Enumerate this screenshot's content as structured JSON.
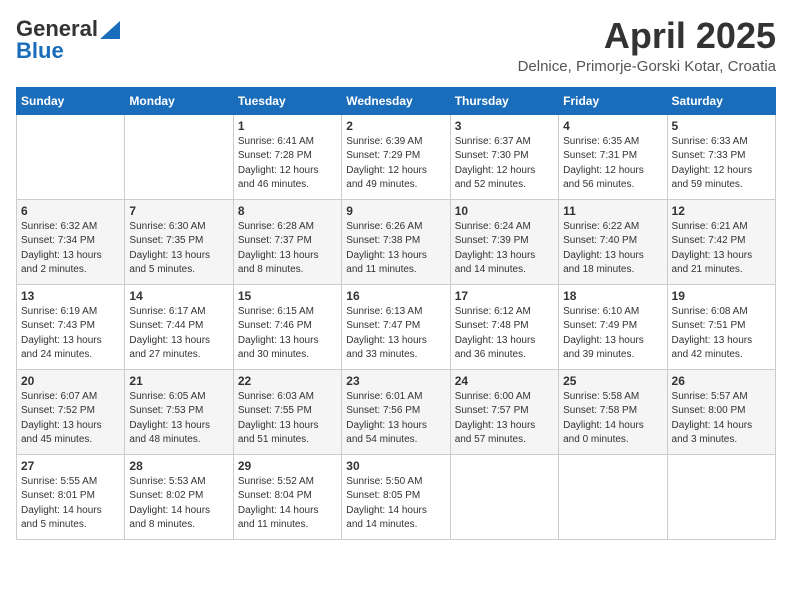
{
  "header": {
    "logo_general": "General",
    "logo_blue": "Blue",
    "month_title": "April 2025",
    "location": "Delnice, Primorje-Gorski Kotar, Croatia"
  },
  "days_of_week": [
    "Sunday",
    "Monday",
    "Tuesday",
    "Wednesday",
    "Thursday",
    "Friday",
    "Saturday"
  ],
  "weeks": [
    [
      {
        "day": "",
        "detail": ""
      },
      {
        "day": "",
        "detail": ""
      },
      {
        "day": "1",
        "detail": "Sunrise: 6:41 AM\nSunset: 7:28 PM\nDaylight: 12 hours\nand 46 minutes."
      },
      {
        "day": "2",
        "detail": "Sunrise: 6:39 AM\nSunset: 7:29 PM\nDaylight: 12 hours\nand 49 minutes."
      },
      {
        "day": "3",
        "detail": "Sunrise: 6:37 AM\nSunset: 7:30 PM\nDaylight: 12 hours\nand 52 minutes."
      },
      {
        "day": "4",
        "detail": "Sunrise: 6:35 AM\nSunset: 7:31 PM\nDaylight: 12 hours\nand 56 minutes."
      },
      {
        "day": "5",
        "detail": "Sunrise: 6:33 AM\nSunset: 7:33 PM\nDaylight: 12 hours\nand 59 minutes."
      }
    ],
    [
      {
        "day": "6",
        "detail": "Sunrise: 6:32 AM\nSunset: 7:34 PM\nDaylight: 13 hours\nand 2 minutes."
      },
      {
        "day": "7",
        "detail": "Sunrise: 6:30 AM\nSunset: 7:35 PM\nDaylight: 13 hours\nand 5 minutes."
      },
      {
        "day": "8",
        "detail": "Sunrise: 6:28 AM\nSunset: 7:37 PM\nDaylight: 13 hours\nand 8 minutes."
      },
      {
        "day": "9",
        "detail": "Sunrise: 6:26 AM\nSunset: 7:38 PM\nDaylight: 13 hours\nand 11 minutes."
      },
      {
        "day": "10",
        "detail": "Sunrise: 6:24 AM\nSunset: 7:39 PM\nDaylight: 13 hours\nand 14 minutes."
      },
      {
        "day": "11",
        "detail": "Sunrise: 6:22 AM\nSunset: 7:40 PM\nDaylight: 13 hours\nand 18 minutes."
      },
      {
        "day": "12",
        "detail": "Sunrise: 6:21 AM\nSunset: 7:42 PM\nDaylight: 13 hours\nand 21 minutes."
      }
    ],
    [
      {
        "day": "13",
        "detail": "Sunrise: 6:19 AM\nSunset: 7:43 PM\nDaylight: 13 hours\nand 24 minutes."
      },
      {
        "day": "14",
        "detail": "Sunrise: 6:17 AM\nSunset: 7:44 PM\nDaylight: 13 hours\nand 27 minutes."
      },
      {
        "day": "15",
        "detail": "Sunrise: 6:15 AM\nSunset: 7:46 PM\nDaylight: 13 hours\nand 30 minutes."
      },
      {
        "day": "16",
        "detail": "Sunrise: 6:13 AM\nSunset: 7:47 PM\nDaylight: 13 hours\nand 33 minutes."
      },
      {
        "day": "17",
        "detail": "Sunrise: 6:12 AM\nSunset: 7:48 PM\nDaylight: 13 hours\nand 36 minutes."
      },
      {
        "day": "18",
        "detail": "Sunrise: 6:10 AM\nSunset: 7:49 PM\nDaylight: 13 hours\nand 39 minutes."
      },
      {
        "day": "19",
        "detail": "Sunrise: 6:08 AM\nSunset: 7:51 PM\nDaylight: 13 hours\nand 42 minutes."
      }
    ],
    [
      {
        "day": "20",
        "detail": "Sunrise: 6:07 AM\nSunset: 7:52 PM\nDaylight: 13 hours\nand 45 minutes."
      },
      {
        "day": "21",
        "detail": "Sunrise: 6:05 AM\nSunset: 7:53 PM\nDaylight: 13 hours\nand 48 minutes."
      },
      {
        "day": "22",
        "detail": "Sunrise: 6:03 AM\nSunset: 7:55 PM\nDaylight: 13 hours\nand 51 minutes."
      },
      {
        "day": "23",
        "detail": "Sunrise: 6:01 AM\nSunset: 7:56 PM\nDaylight: 13 hours\nand 54 minutes."
      },
      {
        "day": "24",
        "detail": "Sunrise: 6:00 AM\nSunset: 7:57 PM\nDaylight: 13 hours\nand 57 minutes."
      },
      {
        "day": "25",
        "detail": "Sunrise: 5:58 AM\nSunset: 7:58 PM\nDaylight: 14 hours\nand 0 minutes."
      },
      {
        "day": "26",
        "detail": "Sunrise: 5:57 AM\nSunset: 8:00 PM\nDaylight: 14 hours\nand 3 minutes."
      }
    ],
    [
      {
        "day": "27",
        "detail": "Sunrise: 5:55 AM\nSunset: 8:01 PM\nDaylight: 14 hours\nand 5 minutes."
      },
      {
        "day": "28",
        "detail": "Sunrise: 5:53 AM\nSunset: 8:02 PM\nDaylight: 14 hours\nand 8 minutes."
      },
      {
        "day": "29",
        "detail": "Sunrise: 5:52 AM\nSunset: 8:04 PM\nDaylight: 14 hours\nand 11 minutes."
      },
      {
        "day": "30",
        "detail": "Sunrise: 5:50 AM\nSunset: 8:05 PM\nDaylight: 14 hours\nand 14 minutes."
      },
      {
        "day": "",
        "detail": ""
      },
      {
        "day": "",
        "detail": ""
      },
      {
        "day": "",
        "detail": ""
      }
    ]
  ]
}
